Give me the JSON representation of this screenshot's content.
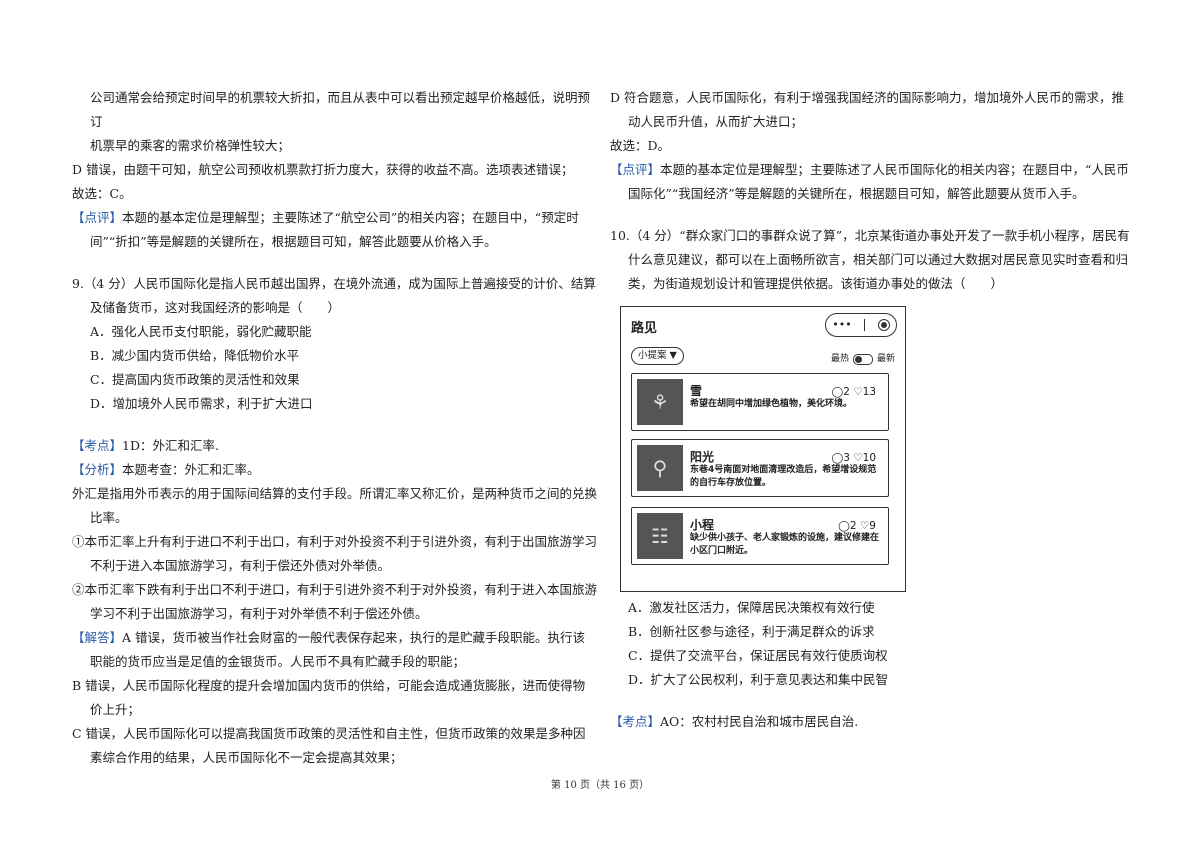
{
  "left": {
    "l1": "公司通常会给预定时间早的机票较大折扣，而且从表中可以看出预定越早价格越低，说明预订",
    "l2": "机票早的乘客的需求价格弹性较大；",
    "l3": "D 错误，由题干可知，航空公司预收机票款打折力度大，获得的收益不高。选项表述错误；",
    "l4": "故选：C。",
    "dp_tag": "【点评】",
    "dp_text": "本题的基本定位是理解型；主要陈述了“航空公司”的相关内容；在题目中，“预定时间”“折扣”等是解题的关键所在，根据题目可知，解答此题要从价格入手。",
    "q9_stem": "9.（4 分）人民币国际化是指人民币越出国界，在境外流通，成为国际上普遍接受的计价、结算及储备货币，这对我国经济的影响是（　　）",
    "q9_options": [
      "A．强化人民币支付职能，弱化贮藏职能",
      "B．减少国内货币供给，降低物价水平",
      "C．提高国内货币政策的灵活性和效果",
      "D．增加境外人民币需求，利于扩大进口"
    ],
    "kd_tag": "【考点】",
    "kd_text": "1D：外汇和汇率.",
    "fx_tag": "【分析】",
    "fx_text": "本题考查：外汇和汇率。",
    "fx_1": "外汇是指用外币表示的用于国际间结算的支付手段。所谓汇率又称汇价，是两种货币之间的兑换比率。",
    "fx_2": "①本币汇率上升有利于进口不利于出口，有利于对外投资不利于引进外资，有利于出国旅游学习不利于进入本国旅游学习，有利于偿还外债对外举债。",
    "fx_3": "②本币汇率下跌有利于出口不利于进口，有利于引进外资不利于对外投资，有利于进入本国旅游学习不利于出国旅游学习，有利于对外举债不利于偿还外债。",
    "jd_tag": "【解答】",
    "jd_text": "A 错误，货币被当作社会财富的一般代表保存起来，执行的是贮藏手段职能。执行该职能的货币应当是足值的金银货币。人民币不具有贮藏手段的职能；",
    "jd_b": "B 错误，人民币国际化程度的提升会增加国内货币的供给，可能会造成通货膨胀，进而使得物价上升；",
    "jd_c": "C 错误，人民币国际化可以提高我国货币政策的灵活性和自主性，但货币政策的效果是多种因素综合作用的结果，人民币国际化不一定会提高其效果；"
  },
  "right": {
    "r1": "D 符合题意，人民币国际化，有利于增强我国经济的国际影响力，增加境外人民币的需求，推动人民币升值，从而扩大进口；",
    "r2": "故选：D。",
    "dp_tag": "【点评】",
    "dp_text": "本题的基本定位是理解型；主要陈述了人民币国际化的相关内容；在题目中，“人民币国际化”“我国经济”等是解题的关键所在，根据题目可知，解答此题要从货币入手。",
    "q10_stem": "10.（4 分）“群众家门口的事群众说了算”，北京某街道办事处开发了一款手机小程序，居民有什么意见建议，都可以在上面畅所欲言，相关部门可以通过大数据对居民意见实时查看和归类，为街道规划设计和管理提供依据。该街道办事处的做法（　　）",
    "q10_options": [
      "A．激发社区活力，保障居民决策权有效行使",
      "B．创新社区参与途径，利于满足群众的诉求",
      "C．提供了交流平台，保证居民有效行使质询权",
      "D．扩大了公民权利，利于意见表达和集中民智"
    ],
    "kd_tag": "【考点】",
    "kd_text": "AO：农村村民自治和城市居民自治."
  },
  "phone": {
    "title": "路见",
    "menu_dots": "•••",
    "select": "小提案 ▼",
    "sort_hot": "最热",
    "sort_new": "最新",
    "cards": [
      {
        "name": "雪",
        "stats": "◯2 ♡13",
        "text": "希望在胡同中增加绿色植物，美化环境。"
      },
      {
        "name": "阳光",
        "stats": "◯3 ♡10",
        "text": "东巷4号南面对地面清理改造后，希望增设规范的自行车存放位置。"
      },
      {
        "name": "小程",
        "stats": "◯2 ♡9",
        "text": "缺少供小孩子、老人家锻炼的设施，建议修建在小区门口附近。"
      }
    ]
  },
  "footer": "第 10 页（共 16 页）"
}
